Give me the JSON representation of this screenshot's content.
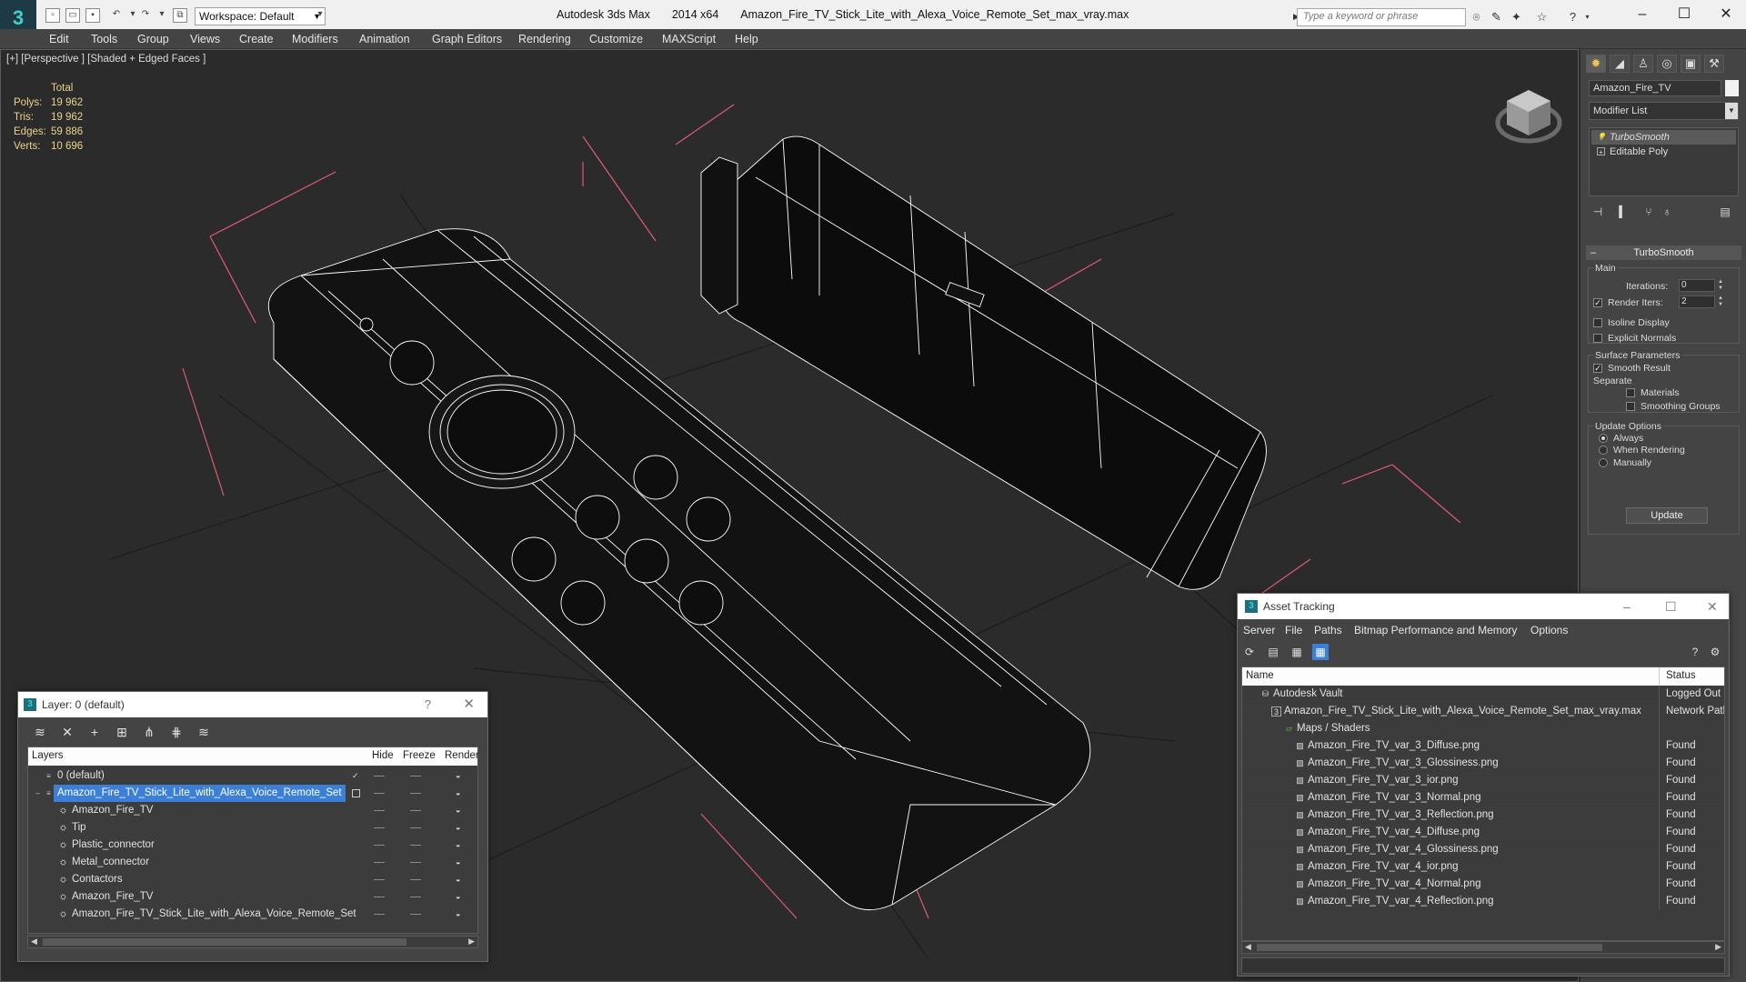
{
  "titlebar": {
    "workspace": "Workspace: Default",
    "app_name": "Autodesk 3ds Max",
    "app_version": "2014 x64",
    "file_name": "Amazon_Fire_TV_Stick_Lite_with_Alexa_Voice_Remote_Set_max_vray.max",
    "search_placeholder": "Type a keyword or phrase",
    "logo_glyph": "3"
  },
  "menus": [
    "Edit",
    "Tools",
    "Group",
    "Views",
    "Create",
    "Modifiers",
    "Animation",
    "Graph Editors",
    "Rendering",
    "Customize",
    "MAXScript",
    "Help"
  ],
  "viewport": {
    "label": "[+] [Perspective ] [Shaded + Edged Faces ]",
    "stats": {
      "header": "Total",
      "rows": [
        {
          "label": "Polys:",
          "value": "19 962"
        },
        {
          "label": "Tris:",
          "value": "19 962"
        },
        {
          "label": "Edges:",
          "value": "59 886"
        },
        {
          "label": "Verts:",
          "value": "10 696"
        }
      ]
    },
    "bg_color": "#2b2b2b",
    "grid_color": "#1a1a1a",
    "wire_color": "#ffffff",
    "bbox_color": "#e05a78"
  },
  "command_panel": {
    "object_name": "Amazon_Fire_TV",
    "modifier_list": "Modifier List",
    "stack": [
      {
        "label": "TurboSmooth",
        "icon": "lightbulb-icon",
        "selected": true
      },
      {
        "label": "Editable Poly",
        "icon": "expand-plus-icon",
        "selected": false
      }
    ],
    "rollout_title": "TurboSmooth",
    "main_group": "Main",
    "iterations_label": "Iterations:",
    "iterations_value": "0",
    "render_iters_label": "Render Iters:",
    "render_iters_value": "2",
    "isoline": "Isoline Display",
    "explicit": "Explicit Normals",
    "surface_group": "Surface Parameters",
    "smooth_result": "Smooth Result",
    "separate": "Separate",
    "materials": "Materials",
    "smoothing_groups": "Smoothing Groups",
    "update_group": "Update Options",
    "always": "Always",
    "when_rendering": "When Rendering",
    "manually": "Manually",
    "update_button": "Update",
    "accent": "#f6c257"
  },
  "layer_dialog": {
    "title": "Layer: 0 (default)",
    "help": "?",
    "columns": [
      "Layers",
      "Hide",
      "Freeze",
      "Render"
    ],
    "rows": [
      {
        "name": "0 (default)",
        "level": 0,
        "selected": false
      },
      {
        "name": "Amazon_Fire_TV_Stick_Lite_with_Alexa_Voice_Remote_Set",
        "level": 0,
        "selected": true
      },
      {
        "name": "Amazon_Fire_TV",
        "level": 1,
        "selected": false
      },
      {
        "name": "Tip",
        "level": 1,
        "selected": false
      },
      {
        "name": "Plastic_connector",
        "level": 1,
        "selected": false
      },
      {
        "name": "Metal_connector",
        "level": 1,
        "selected": false
      },
      {
        "name": "Contactors",
        "level": 1,
        "selected": false
      },
      {
        "name": "Amazon_Fire_TV",
        "level": 1,
        "selected": false
      },
      {
        "name": "Amazon_Fire_TV_Stick_Lite_with_Alexa_Voice_Remote_Set",
        "level": 1,
        "selected": false
      }
    ],
    "selection_color": "#3c7fd7"
  },
  "asset_dialog": {
    "title": "Asset Tracking",
    "menus": [
      "Server",
      "File",
      "Paths",
      "Bitmap Performance and Memory",
      "Options"
    ],
    "columns": [
      "Name",
      "Status"
    ],
    "rows": [
      {
        "name": "Autodesk Vault",
        "status": "Logged Out",
        "level": 1
      },
      {
        "name": "Amazon_Fire_TV_Stick_Lite_with_Alexa_Voice_Remote_Set_max_vray.max",
        "status": "Network Path",
        "level": 2
      },
      {
        "name": "Maps / Shaders",
        "status": "",
        "level": 3
      },
      {
        "name": "Amazon_Fire_TV_var_3_Diffuse.png",
        "status": "Found",
        "level": 4
      },
      {
        "name": "Amazon_Fire_TV_var_3_Glossiness.png",
        "status": "Found",
        "level": 4
      },
      {
        "name": "Amazon_Fire_TV_var_3_ior.png",
        "status": "Found",
        "level": 4
      },
      {
        "name": "Amazon_Fire_TV_var_3_Normal.png",
        "status": "Found",
        "level": 4
      },
      {
        "name": "Amazon_Fire_TV_var_3_Reflection.png",
        "status": "Found",
        "level": 4
      },
      {
        "name": "Amazon_Fire_TV_var_4_Diffuse.png",
        "status": "Found",
        "level": 4
      },
      {
        "name": "Amazon_Fire_TV_var_4_Glossiness.png",
        "status": "Found",
        "level": 4
      },
      {
        "name": "Amazon_Fire_TV_var_4_ior.png",
        "status": "Found",
        "level": 4
      },
      {
        "name": "Amazon_Fire_TV_var_4_Normal.png",
        "status": "Found",
        "level": 4
      },
      {
        "name": "Amazon_Fire_TV_var_4_Reflection.png",
        "status": "Found",
        "level": 4
      }
    ]
  }
}
